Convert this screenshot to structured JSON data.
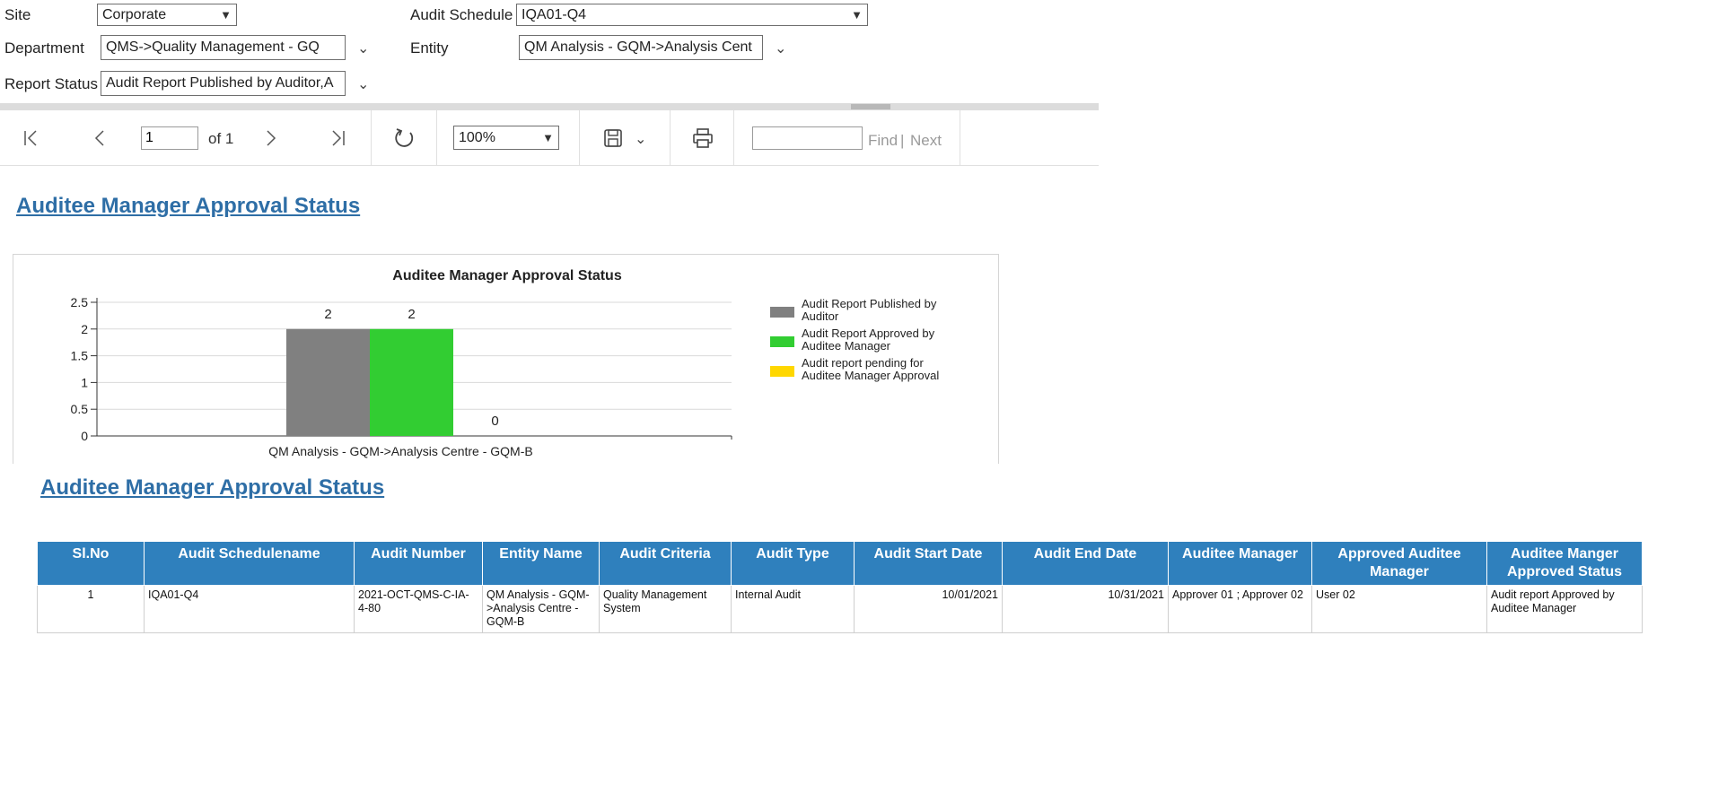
{
  "params": {
    "site": {
      "label": "Site",
      "value": "Corporate"
    },
    "audit_schedule": {
      "label": "Audit Schedule",
      "value": "IQA01-Q4"
    },
    "department": {
      "label": "Department",
      "value": "QMS->Quality Management - GQ"
    },
    "entity": {
      "label": "Entity",
      "value": "QM Analysis - GQM->Analysis Cent"
    },
    "report_status": {
      "label": "Report Status",
      "value": "Audit Report Published by Auditor,A"
    }
  },
  "toolbar": {
    "page_value": "1",
    "page_of": "of 1",
    "zoom": "100%",
    "find_label": "Find",
    "find_sep": "|",
    "next_label": "Next",
    "find_value": ""
  },
  "report": {
    "title1": "Auditee Manager Approval Status",
    "title2": "Auditee Manager Approval Status"
  },
  "chart_data": {
    "type": "bar",
    "title": "Auditee Manager Approval Status",
    "categories": [
      "QM Analysis - GQM->Analysis Centre - GQM-B"
    ],
    "series": [
      {
        "name": "Audit Report Published by Auditor",
        "values": [
          2
        ],
        "color": "#808080"
      },
      {
        "name": "Audit Report Approved by Auditee Manager",
        "values": [
          2
        ],
        "color": "#32cd32"
      },
      {
        "name": "Audit report pending for Auditee Manager Approval",
        "values": [
          0
        ],
        "color": "#ffd700"
      }
    ],
    "yticks": [
      "0",
      "0.5",
      "1",
      "1.5",
      "2",
      "2.5"
    ],
    "ylim": [
      0,
      2.5
    ],
    "xlabel": "",
    "ylabel": "",
    "legend": "right",
    "grid": true
  },
  "table": {
    "headers": [
      "Sl.No",
      "Audit Schedulename",
      "Audit Number",
      "Entity Name",
      "Audit Criteria",
      "Audit Type",
      "Audit Start Date",
      "Audit End Date",
      "Auditee Manager",
      "Approved Auditee Manager",
      "Auditee Manger Approved Status"
    ],
    "rows": [
      [
        "1",
        "IQA01-Q4",
        "2021-OCT-QMS-C-IA-4-80",
        "QM Analysis - GQM->Analysis Centre - GQM-B",
        "Quality Management System",
        "Internal Audit",
        "10/01/2021",
        "10/31/2021",
        "Approver 01   ; Approver 02",
        "User 02",
        "Audit report Approved by Auditee Manager"
      ]
    ]
  }
}
